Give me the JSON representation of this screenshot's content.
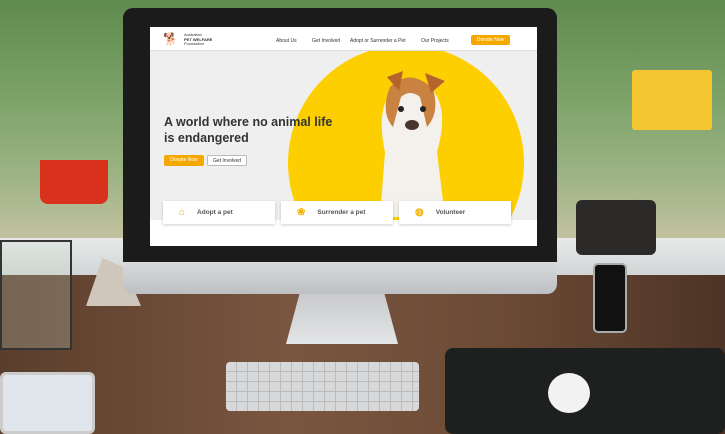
{
  "site": {
    "logo": {
      "line1": "Australian",
      "line2": "PET WELFARE",
      "line3": "Foundation",
      "icon": "dog-cat-logo"
    },
    "nav": [
      {
        "label": "About Us"
      },
      {
        "label": "Get Involved"
      },
      {
        "label": "Adopt or Surrender a Pet"
      },
      {
        "label": "Our Projects"
      }
    ],
    "nav_cta": "Donate Now",
    "hero": {
      "headline": "A world where no animal life is endangered",
      "primary": "Donate Now",
      "secondary": "Get Involved"
    },
    "cards": [
      {
        "label": "Adopt a pet",
        "icon": "house-icon"
      },
      {
        "label": "Surrender a pet",
        "icon": "paw-icon"
      },
      {
        "label": "Volunteer",
        "icon": "globe-icon"
      }
    ],
    "colors": {
      "accent": "#f5a800",
      "hero_circle": "#fecf00"
    }
  }
}
